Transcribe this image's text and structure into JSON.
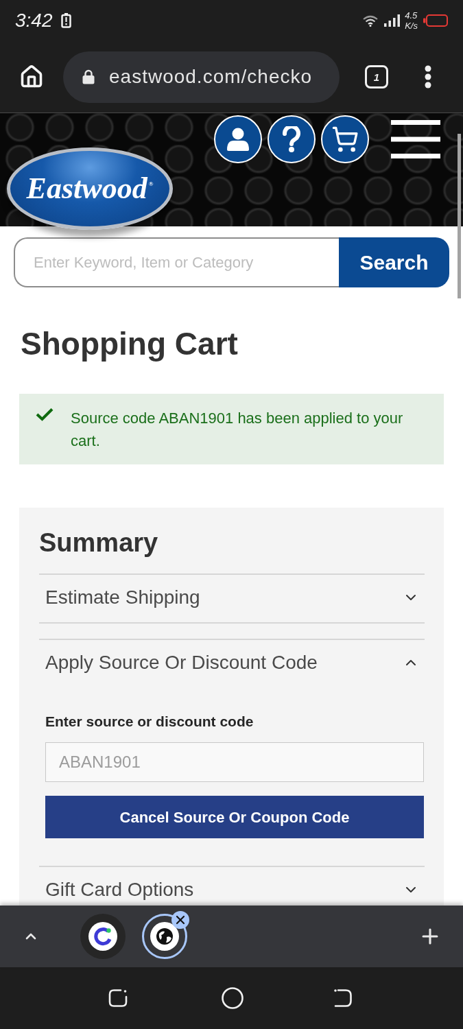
{
  "status_bar": {
    "time": "3:42",
    "net_speed": "4.5",
    "net_speed_unit": "K/s"
  },
  "browser": {
    "url": "eastwood.com/checko",
    "tab_count": "1"
  },
  "header": {
    "logo": "Eastwood$^{®}$"
  },
  "search": {
    "placeholder": "Enter Keyword, Item or Category",
    "button": "Search"
  },
  "page_title": "Shopping Cart",
  "message": {
    "text": "Source code ABAN1901 has been applied to your cart."
  },
  "summary": {
    "title": "Summary",
    "sections": [
      {
        "title": "Estimate Shipping",
        "expanded": false
      },
      {
        "title": "Apply Source Or Discount Code",
        "expanded": true,
        "field": {
          "label": "Enter source or discount code",
          "value": "ABAN1901",
          "disabled": true
        },
        "button": "Cancel Source Or Coupon Code"
      },
      {
        "title": "Gift Card Options",
        "expanded": false
      }
    ]
  },
  "tab_strip": {
    "tabs": [
      {
        "kind": "logo",
        "selected": false
      },
      {
        "kind": "globe",
        "selected": true
      }
    ]
  }
}
